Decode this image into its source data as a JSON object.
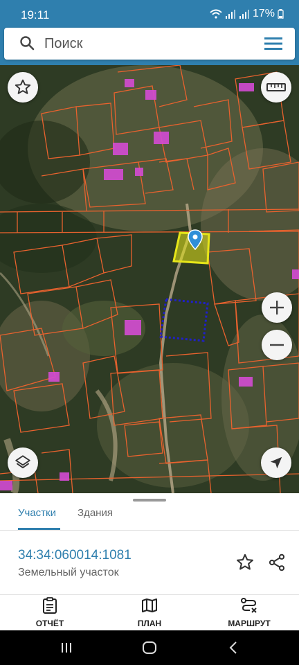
{
  "status": {
    "time": "19:11",
    "battery": "17%"
  },
  "search": {
    "placeholder": "Поиск"
  },
  "tabs": [
    {
      "label": "Участки"
    },
    {
      "label": "Здания"
    }
  ],
  "parcel": {
    "number": "34:34:060014:1081",
    "type": "Земельный участок"
  },
  "bottom_nav": [
    {
      "label": "ОТЧЁТ"
    },
    {
      "label": "ПЛАН"
    },
    {
      "label": "МАРШРУТ"
    }
  ],
  "colors": {
    "accent": "#2f7fae",
    "parcel_border": "#e8622e",
    "selected_fill": "#e6e619",
    "building": "#d44bd4",
    "dotted": "#2020c8"
  },
  "icons": [
    "search-icon",
    "menu-icon",
    "favorite-icon",
    "ruler-icon",
    "location-pin-icon",
    "zoom-in-icon",
    "zoom-out-icon",
    "layers-icon",
    "navigation-arrow-icon",
    "star-icon",
    "share-icon",
    "report-icon",
    "map-plan-icon",
    "route-icon",
    "recents-icon",
    "home-icon",
    "back-icon"
  ]
}
